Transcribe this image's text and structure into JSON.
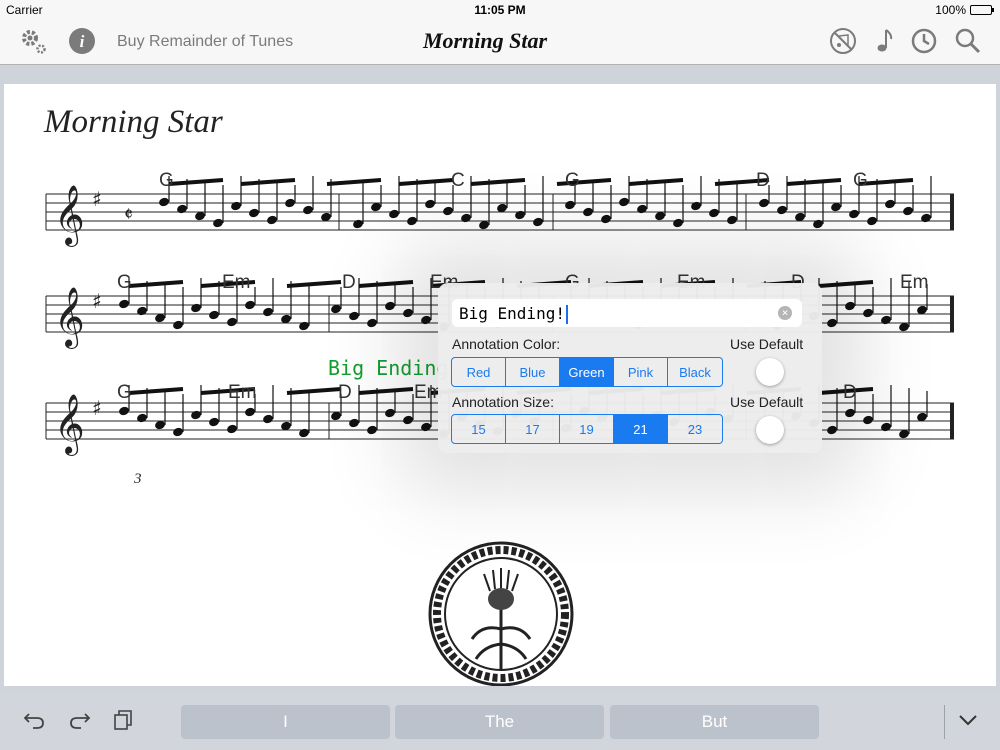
{
  "status": {
    "carrier": "Carrier",
    "time": "11:05 PM",
    "battery": "100%"
  },
  "nav": {
    "buy_label": "Buy Remainder of Tunes",
    "title": "Morning Star"
  },
  "sheet": {
    "title": "Morning Star",
    "row1_chords": [
      "G",
      "C",
      "G",
      "D",
      "G"
    ],
    "row2_chords": [
      "G",
      "Em",
      "D",
      "Em",
      "G",
      "Em",
      "D",
      "Em"
    ],
    "row3_chords": [
      "G",
      "Em",
      "D",
      "Em",
      "D"
    ],
    "triplet": "3",
    "annotation": "Big Ending"
  },
  "popover": {
    "text_value": "Big Ending!",
    "color_label": "Annotation Color:",
    "use_default_1": "Use Default",
    "colors": [
      "Red",
      "Blue",
      "Green",
      "Pink",
      "Black"
    ],
    "selected_color": "Green",
    "size_label": "Annotation Size:",
    "use_default_2": "Use Default",
    "sizes": [
      "15",
      "17",
      "19",
      "21",
      "23"
    ],
    "selected_size": "21"
  },
  "keyboard": {
    "suggestions": [
      "I",
      "The",
      "But"
    ]
  },
  "colors": {
    "accent": "#1a7af0",
    "annotation": "#139e2e",
    "icon_gray": "#7b7b7b"
  },
  "icons": [
    "gear-icon",
    "info-icon",
    "no-audio-icon",
    "music-note-icon",
    "clock-icon",
    "search-icon",
    "undo-icon",
    "redo-icon",
    "paste-icon",
    "chevron-down-icon"
  ]
}
